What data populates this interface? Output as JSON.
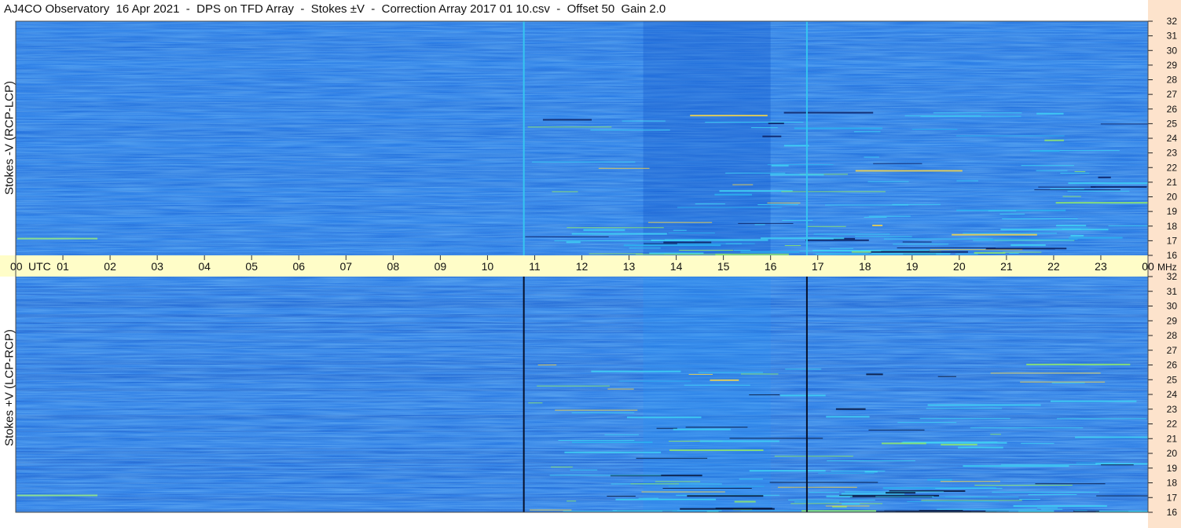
{
  "title": "AJ4CO Observatory  16 Apr 2021  -  DPS on TFD Array  -  Stokes ±V  -  Correction Array 2017 01 10.csv  -  Offset 50  Gain 2.0",
  "colors": {
    "background": "#1f6fe0",
    "time_axis_band": "#fffdc8",
    "freq_axis_band": "#fde3cc",
    "top_vertical_lines": "#35c6f0",
    "bottom_vertical_lines": "#06102a"
  },
  "chart_data": [
    {
      "type": "heatmap",
      "panel": "top",
      "ylabel": "Stokes -V (RCP-LCP)",
      "x_unit": "UTC",
      "x_range": [
        0,
        24
      ],
      "x_ticks": [
        "00",
        "01",
        "02",
        "03",
        "04",
        "05",
        "06",
        "07",
        "08",
        "09",
        "10",
        "11",
        "12",
        "13",
        "14",
        "15",
        "16",
        "17",
        "18",
        "19",
        "20",
        "21",
        "22",
        "23",
        "00"
      ],
      "y_unit": "MHz",
      "y_range": [
        16,
        32
      ],
      "y_ticks": [
        "16",
        "17",
        "18",
        "19",
        "20",
        "21",
        "22",
        "23",
        "24",
        "25",
        "26",
        "27",
        "28",
        "29",
        "30",
        "31",
        "32"
      ],
      "vertical_markers_utc": [
        10.77,
        16.77
      ]
    },
    {
      "type": "heatmap",
      "panel": "bottom",
      "ylabel": "Stokes +V (LCP-RCP)",
      "x_unit": "UTC",
      "x_range": [
        0,
        24
      ],
      "x_ticks": [
        "00",
        "01",
        "02",
        "03",
        "04",
        "05",
        "06",
        "07",
        "08",
        "09",
        "10",
        "11",
        "12",
        "13",
        "14",
        "15",
        "16",
        "17",
        "18",
        "19",
        "20",
        "21",
        "22",
        "23",
        "00"
      ],
      "y_unit": "MHz",
      "y_range": [
        16,
        32
      ],
      "y_ticks": [
        "16",
        "17",
        "18",
        "19",
        "20",
        "21",
        "22",
        "23",
        "24",
        "25",
        "26",
        "27",
        "28",
        "29",
        "30",
        "31",
        "32"
      ],
      "vertical_markers_utc": [
        10.77,
        16.77
      ]
    }
  ]
}
